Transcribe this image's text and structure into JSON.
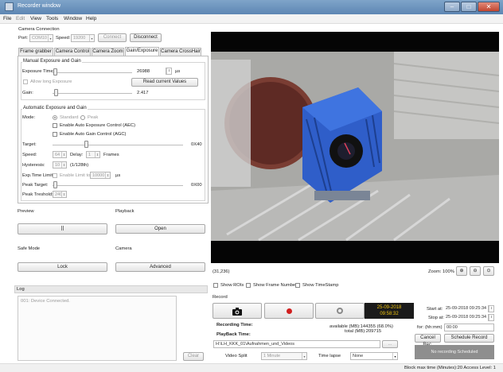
{
  "window": {
    "title": "Recorder window"
  },
  "menu": [
    "File",
    "Edit",
    "View",
    "Tools",
    "Window",
    "Help"
  ],
  "camera_connection": {
    "header": "Camera Connection",
    "port_label": "Port:",
    "port_value": "COM10",
    "speed_label": "Speed:",
    "speed_value": "19200",
    "connect_label": "Connect",
    "disconnect_label": "Disconnect"
  },
  "tabs": [
    "Frame grabber",
    "Camera Control",
    "Camera Zoom",
    "Gain/Exposure",
    "Camera CrossHair"
  ],
  "manual": {
    "header": "Manual Exposure and Gain",
    "exposure_label": "Exposure Time:",
    "exposure_value": "26988",
    "exposure_unit": "µs",
    "allow_long_label": "Allow long Exposure",
    "read_values_label": "Read current Values",
    "gain_label": "Gain:",
    "gain_value": "2.417"
  },
  "auto": {
    "header": "Automatic Exposure and Gain",
    "mode_label": "Mode:",
    "mode_standard": "Standard",
    "mode_peak": "Peak",
    "aec_label": "Enable Auto Exposure Control (AEC)",
    "agc_label": "Enable Auto Gain Control (AGC)",
    "target_label": "Target:",
    "target_value": "0X40",
    "speed_label": "Speed:",
    "speed_value": "64",
    "delay_label": "Delay:",
    "delay_value": "1",
    "frames_label": "Frames",
    "hysteresis_label": "Hysteresis:",
    "hysteresis_value": "10",
    "hysteresis_ratio": "(1/128th)",
    "exp_limit_label": "Exp.Time Limit:",
    "enable_limit_label": "Enable Limit to",
    "limit_value": "10000",
    "limit_unit": "µs",
    "peak_target_label": "Peak Target:",
    "peak_target_value": "0X00",
    "peak_threshold_label": "Peak Treshold:",
    "peak_threshold_value": "240"
  },
  "preview": {
    "header": "Preview",
    "pause_glyph": "II"
  },
  "playback": {
    "header": "Playback",
    "open_label": "Open"
  },
  "safe_mode": {
    "header": "Safe Mode",
    "lock_label": "Lock"
  },
  "camera": {
    "header": "Camera",
    "advanced_label": "Advanced"
  },
  "log": {
    "header": "Log",
    "entry": "001: Device Connected.",
    "clear_label": "Clear"
  },
  "view": {
    "coords": "(31,236)",
    "zoom_label": "Zoom: 100%",
    "show_rois": "Show ROIs",
    "show_frame_number": "Show Frame Number",
    "show_timestamp": "Show TimeStamp"
  },
  "record": {
    "header": "Record",
    "date": "25-09-2018",
    "time": "09:58:32",
    "recording_time_label": "Recording Time:",
    "playback_time_label": "PlayBack Time:",
    "available": "available (MB):144355 (68.0%)",
    "total": "total (MB):209715",
    "path": "H:\\LH_KKK_01\\Aufnahmen_und_Videos",
    "browse_label": "...",
    "video_split_label": "Video Split",
    "video_split_value": "1 Minute",
    "time_lapse_label": "Time lapse",
    "time_lapse_value": "None",
    "start_label": "Start at:",
    "start_value": "25-09-2018 09:25:34",
    "stop_label": "Stop at:",
    "stop_value": "25-09-2018 09:25:34",
    "for_label": "for: (hh:mm)",
    "for_value": "00:00",
    "cancel_label": "Cancel Rec.",
    "schedule_label": "Schedule Record",
    "no_schedule": "No recording Scheduled"
  },
  "status": {
    "text": "Block max time (Minutes):20  Access Level: 1"
  },
  "colors": {
    "titlebar": "#6a90bb",
    "record_red": "#d11f1f",
    "clock_bg": "#1b1b1b",
    "clock_fg": "#f1c40f",
    "camera_blue": "#2f5ec9"
  }
}
